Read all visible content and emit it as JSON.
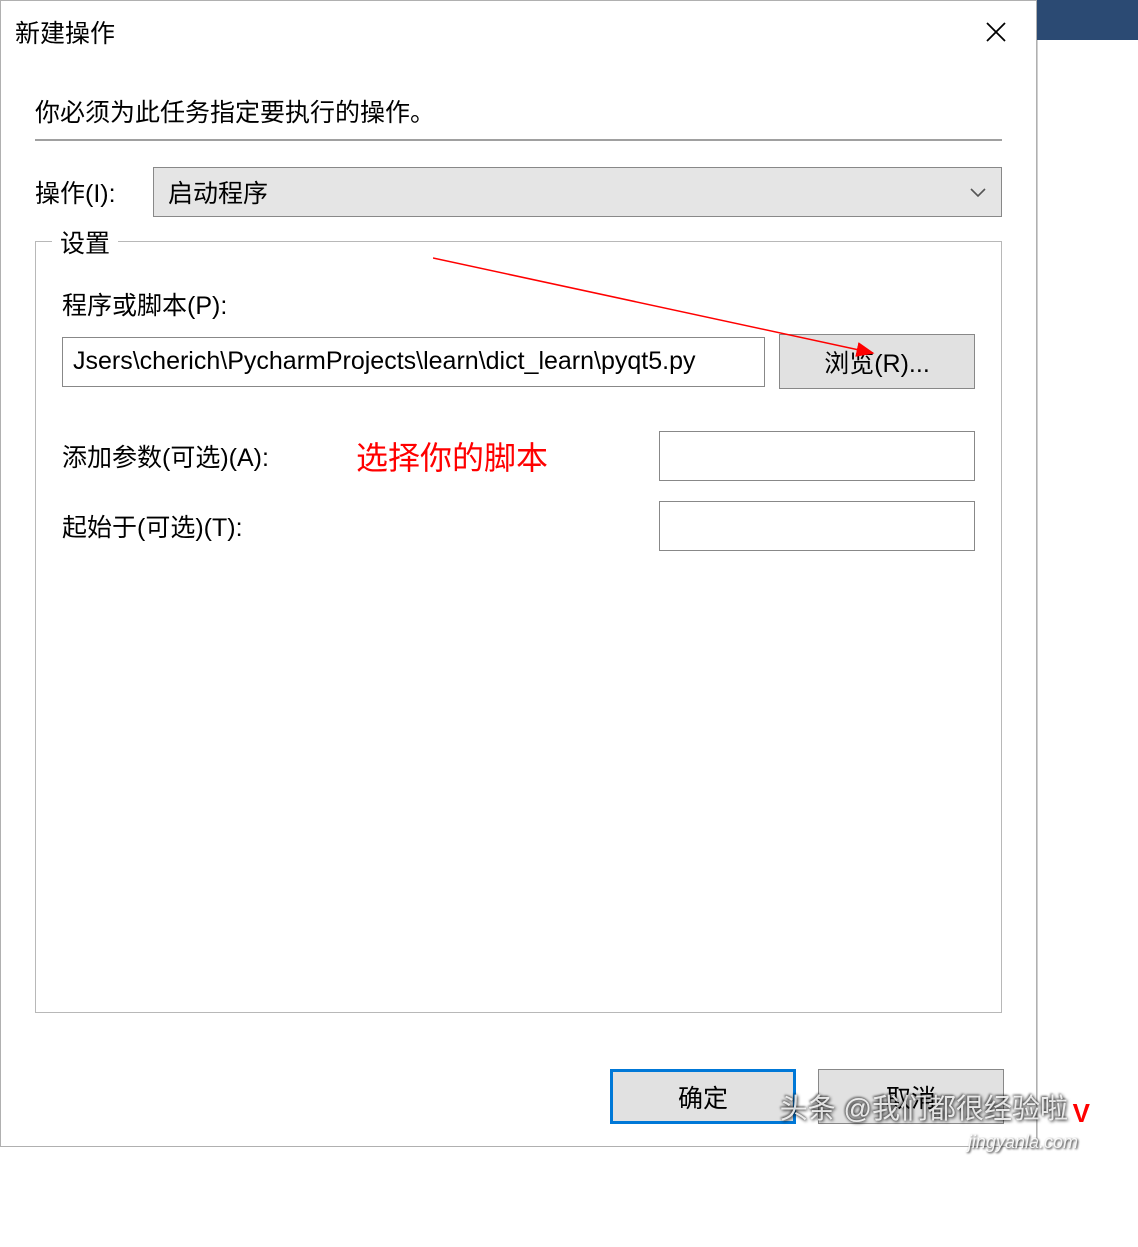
{
  "window": {
    "title": "新建操作",
    "instruction": "你必须为此任务指定要执行的操作。",
    "action_label": "操作(I):",
    "action_value": "启动程序"
  },
  "settings": {
    "legend": "设置",
    "script_label": "程序或脚本(P):",
    "script_value": "Jsers\\cherich\\PycharmProjects\\learn\\dict_learn\\pyqt5.py",
    "browse_label": "浏览(R)...",
    "args_label": "添加参数(可选)(A):",
    "args_value": "",
    "startin_label": "起始于(可选)(T):",
    "startin_value": ""
  },
  "annotation": {
    "text": "选择你的脚本"
  },
  "footer": {
    "ok": "确定",
    "cancel": "取消"
  },
  "watermarks": {
    "w1": "头条 @我们都很",
    "w2": "经验啦",
    "w3": "jingyanla.com",
    "v": "V"
  }
}
